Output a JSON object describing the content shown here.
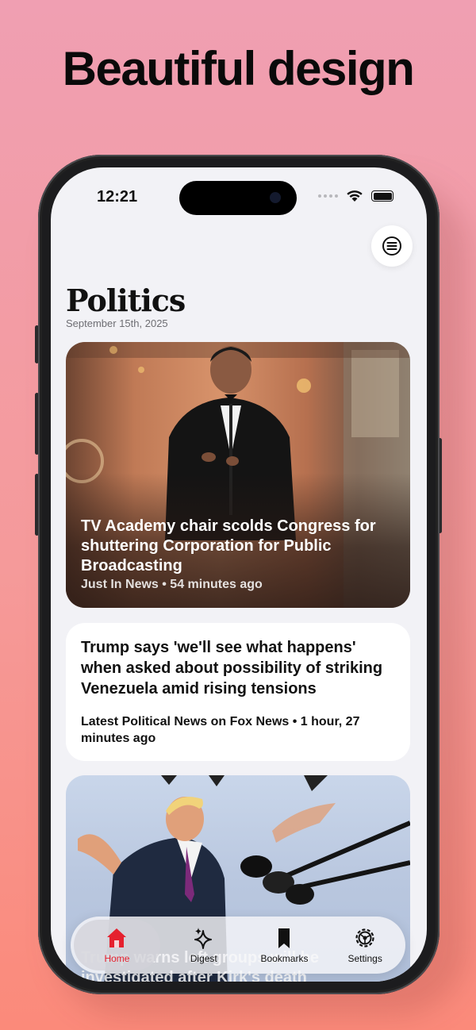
{
  "marketing": {
    "headline": "Beautiful design"
  },
  "status_bar": {
    "time": "12:21"
  },
  "header": {
    "title": "Politics",
    "date": "September 15th, 2025"
  },
  "articles": [
    {
      "title": "TV Academy chair scolds Congress for shuttering Corporation for Public Broadcasting",
      "source": "Just In News",
      "time": "54 minutes ago",
      "meta": "Just In News • 54 minutes ago"
    },
    {
      "title": "Trump says 'we'll see what happens' when asked about possibility of striking Venezuela amid rising tensions",
      "source": "Latest Political News on Fox News",
      "time": "1 hour, 27 minutes ago",
      "meta": "Latest Political News on Fox News • 1 hour, 27 minutes ago"
    },
    {
      "title_partial": "Trump warns left groups will be investigated after Kirk's death"
    }
  ],
  "tabbar": {
    "items": [
      {
        "label": "Home",
        "icon": "home-icon",
        "active": true
      },
      {
        "label": "Digest",
        "icon": "sparkles-icon",
        "active": false
      },
      {
        "label": "Bookmarks",
        "icon": "bookmark-icon",
        "active": false
      },
      {
        "label": "Settings",
        "icon": "gear-icon",
        "active": false
      }
    ]
  },
  "colors": {
    "accent": "#e5202e",
    "background": "#f2f2f6"
  }
}
